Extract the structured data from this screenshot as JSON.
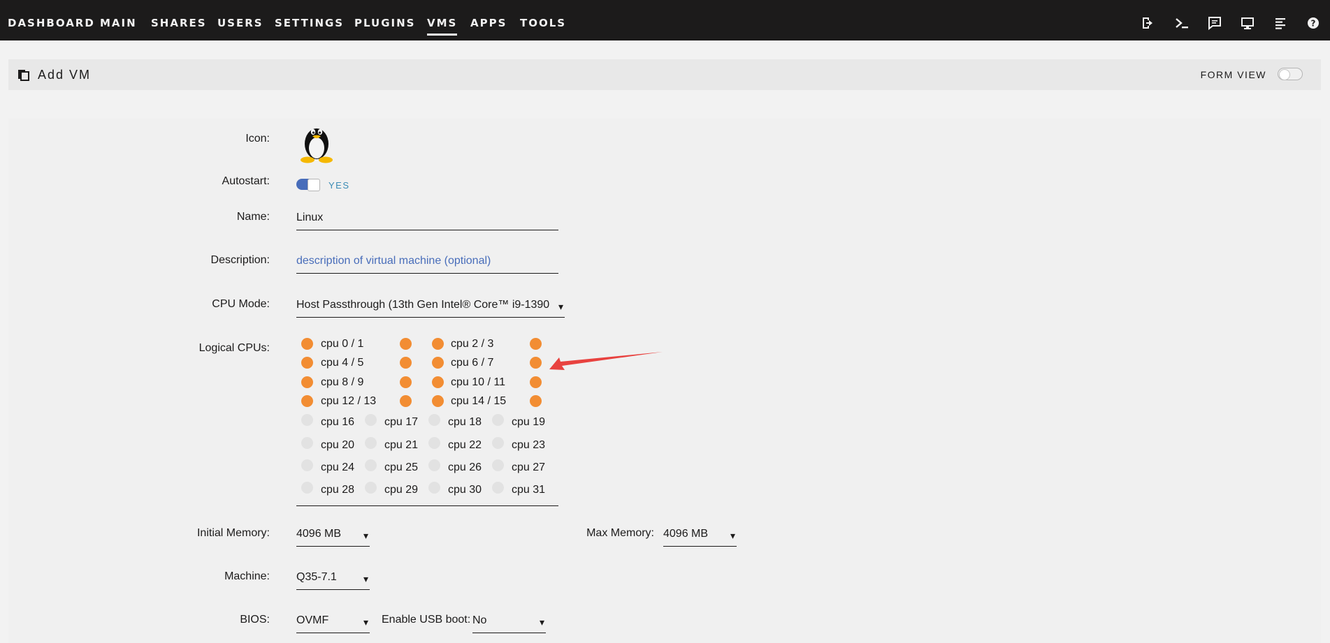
{
  "nav": {
    "tabs": [
      {
        "label": "DASHBOARD",
        "active": false
      },
      {
        "label": "MAIN",
        "active": false
      },
      {
        "label": "SHARES",
        "active": false
      },
      {
        "label": "USERS",
        "active": false
      },
      {
        "label": "SETTINGS",
        "active": false
      },
      {
        "label": "PLUGINS",
        "active": false
      },
      {
        "label": "VMS",
        "active": true
      },
      {
        "label": "APPS",
        "active": false
      },
      {
        "label": "TOOLS",
        "active": false
      }
    ],
    "right_icons": [
      "logout-icon",
      "terminal-icon",
      "feedback-icon",
      "display-icon",
      "log-icon",
      "help-icon"
    ]
  },
  "titlebar": {
    "title": "Add VM",
    "form_view_label": "FORM VIEW"
  },
  "form": {
    "icon_label": "Icon:",
    "autostart_label": "Autostart:",
    "autostart_value": "YES",
    "name_label": "Name:",
    "name_value": "Linux",
    "description_label": "Description:",
    "description_placeholder": "description of virtual machine (optional)",
    "cpu_mode_label": "CPU Mode:",
    "cpu_mode_value": "Host Passthrough (13th Gen Intel® Core™ i9-1390",
    "logical_cpus_label": "Logical CPUs:",
    "initial_memory_label": "Initial Memory:",
    "initial_memory_value": "4096 MB",
    "max_memory_label": "Max Memory:",
    "max_memory_value": "4096 MB",
    "machine_label": "Machine:",
    "machine_value": "Q35-7.1",
    "bios_label": "BIOS:",
    "bios_value": "OVMF",
    "usb_boot_label": "Enable USB boot:",
    "usb_boot_value": "No"
  },
  "cpus": {
    "paired": [
      "cpu 0 / 1",
      "cpu 2 / 3",
      "cpu 4 / 5",
      "cpu 6 / 7",
      "cpu 8 / 9",
      "cpu 10 / 11",
      "cpu 12 / 13",
      "cpu 14 / 15"
    ],
    "single": [
      "cpu 16",
      "cpu 17",
      "cpu 18",
      "cpu 19",
      "cpu 20",
      "cpu 21",
      "cpu 22",
      "cpu 23",
      "cpu 24",
      "cpu 25",
      "cpu 26",
      "cpu 27",
      "cpu 28",
      "cpu 29",
      "cpu 30",
      "cpu 31"
    ]
  },
  "colors": {
    "accent_orange": "#f28d33",
    "toggle_blue": "#486dba",
    "arrow_red": "#e8423f",
    "nav_bg": "#1c1b1b"
  }
}
